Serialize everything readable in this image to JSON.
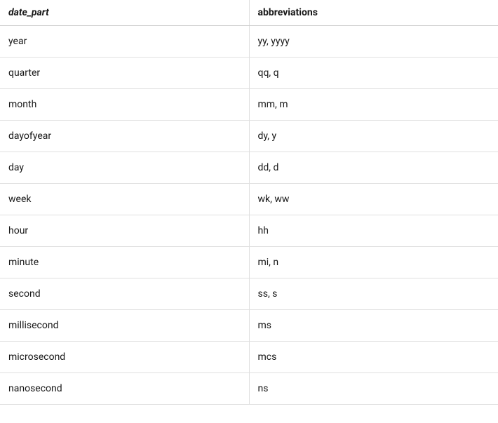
{
  "table": {
    "headers": {
      "col1": "date_part",
      "col2": "abbreviations"
    },
    "rows": [
      {
        "date_part": "year",
        "abbreviations": "yy, yyyy"
      },
      {
        "date_part": "quarter",
        "abbreviations": "qq, q"
      },
      {
        "date_part": "month",
        "abbreviations": "mm, m"
      },
      {
        "date_part": "dayofyear",
        "abbreviations": "dy, y"
      },
      {
        "date_part": "day",
        "abbreviations": "dd, d"
      },
      {
        "date_part": "week",
        "abbreviations": "wk, ww"
      },
      {
        "date_part": "hour",
        "abbreviations": "hh"
      },
      {
        "date_part": "minute",
        "abbreviations": "mi, n"
      },
      {
        "date_part": "second",
        "abbreviations": "ss, s"
      },
      {
        "date_part": "millisecond",
        "abbreviations": "ms"
      },
      {
        "date_part": "microsecond",
        "abbreviations": "mcs"
      },
      {
        "date_part": "nanosecond",
        "abbreviations": "ns"
      }
    ]
  }
}
